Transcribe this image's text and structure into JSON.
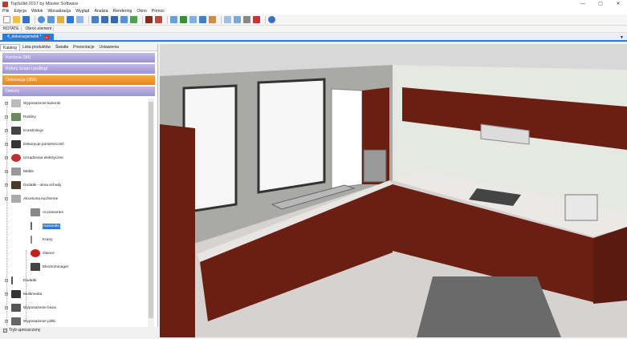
{
  "window": {
    "title": "TopSolid 2017 by Missler Software",
    "controls": [
      "—",
      "▢",
      "✕"
    ]
  },
  "menu": [
    "Plik",
    "Edycja",
    "Widok",
    "Wizualizacja",
    "Wygląd",
    "Analiza",
    "Rendering",
    "Okno",
    "Pomoc"
  ],
  "subbar": [
    "ROTATE",
    "Obróć element"
  ],
  "doc_tab": {
    "label": "4_dekoracjemebli *",
    "close": "x"
  },
  "panel": {
    "tabs": [
      "Katalog",
      "Lista produktów",
      "Światła",
      "Prezentacje",
      "Ustawienia"
    ],
    "categories": [
      "Kuchnia (98)",
      "Kolory ścian i podłogi",
      "Dekoracje (358)",
      "Dekory"
    ],
    "tree": [
      {
        "label": "Wyposażenie łazienki",
        "level": 0
      },
      {
        "label": "Rośliny",
        "level": 0
      },
      {
        "label": "Konstrukcje",
        "level": 0
      },
      {
        "label": "Dekoracje pomieszczeń",
        "level": 0
      },
      {
        "label": "Urządzenia elektryczne",
        "level": 0
      },
      {
        "label": "Meble",
        "level": 0
      },
      {
        "label": "Dodatki - okna schody",
        "level": 0
      },
      {
        "label": "Akcesoria kuchenne",
        "level": 0
      },
      {
        "label": "Accessories",
        "level": 1
      },
      {
        "label": "Nassedło",
        "level": 1,
        "selected": true
      },
      {
        "label": "Krany",
        "level": 1
      },
      {
        "label": "Owoce",
        "level": 1
      },
      {
        "label": "Electrominager",
        "level": 1
      },
      {
        "label": "Dodatki",
        "level": 0
      },
      {
        "label": "Multimedia",
        "level": 0
      },
      {
        "label": "Wyposażenie biura",
        "level": 0
      },
      {
        "label": "Wyposażenie półki",
        "level": 0
      }
    ],
    "checkbox_label": "Tryb uproszczony"
  },
  "colors": {
    "accent": "#2a7bd6",
    "active_category": "#e8871a",
    "category": "#9c94d6",
    "cabinet": "#6b1e12"
  }
}
